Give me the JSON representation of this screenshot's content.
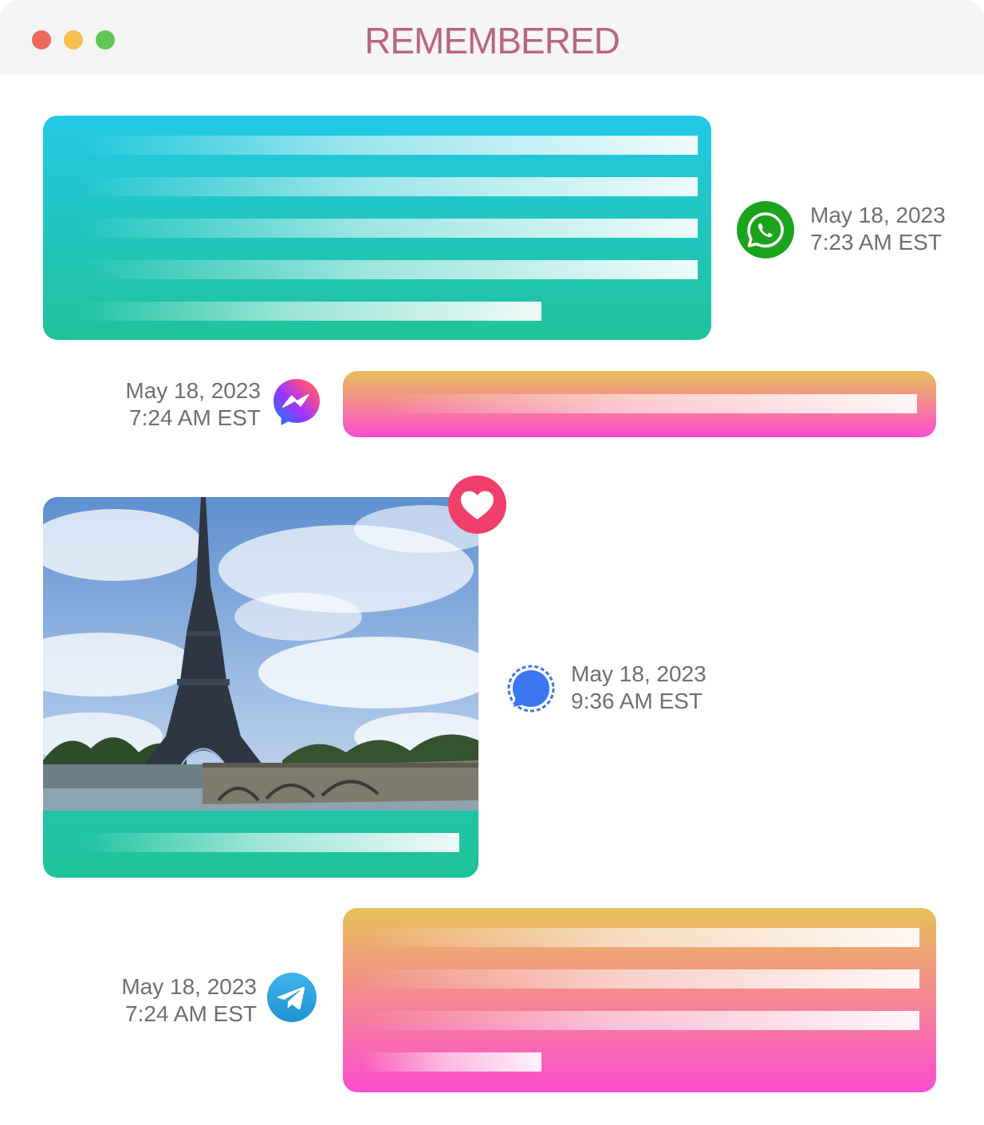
{
  "window": {
    "title": "REMEMBERED",
    "traffic_lights": {
      "close": "#ec6a5e",
      "minimize": "#f4bf4f",
      "zoom": "#61c554"
    }
  },
  "colors": {
    "title": "#b86585",
    "timestamp": "#6f6f6f",
    "teal_bubble": [
      "#22c8e6",
      "#1fc39a"
    ],
    "pink_bubble": [
      "#e7c15a",
      "#f48c8c",
      "#fb4ed0"
    ]
  },
  "messages": [
    {
      "app_icon": "whatsapp-icon",
      "date": "May 18, 2023",
      "time": "7:23 AM EST"
    },
    {
      "app_icon": "messenger-icon",
      "date": "May 18, 2023",
      "time": "7:24 AM EST"
    },
    {
      "app_icon": "signal-icon",
      "date": "May 18, 2023",
      "time": "9:36 AM EST",
      "reaction": "heart-icon",
      "attachment": "eiffel-tower-photo"
    },
    {
      "app_icon": "telegram-icon",
      "date": "May 18, 2023",
      "time": "7:24 AM EST"
    }
  ]
}
